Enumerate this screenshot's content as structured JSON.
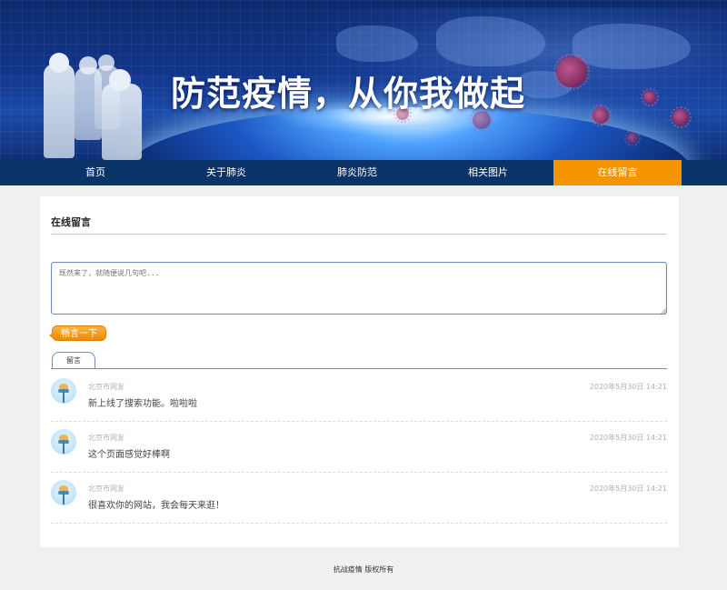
{
  "banner": {
    "title": "防范疫情，从你我做起"
  },
  "nav": {
    "items": [
      {
        "label": "首页"
      },
      {
        "label": "关于肺炎"
      },
      {
        "label": "肺炎防范"
      },
      {
        "label": "相关图片"
      },
      {
        "label": "在线留言",
        "active": true
      }
    ]
  },
  "panel": {
    "title": "在线留言",
    "input_placeholder": "既然来了，就随便说几句吧...",
    "submit_label": "畅言一下",
    "tab_label": "留言"
  },
  "comments": [
    {
      "author": "北京市网友",
      "time": "2020年5月30日 14:21",
      "text": "新上线了搜索功能。啦啦啦"
    },
    {
      "author": "北京市网友",
      "time": "2020年5月30日 14:21",
      "text": "这个页面感觉好棒啊"
    },
    {
      "author": "北京市网友",
      "time": "2020年5月30日 14:21",
      "text": "很喜欢你的网站，我会每天来逛！"
    }
  ],
  "footer": {
    "text": "抗战疫情 版权所有"
  },
  "colors": {
    "nav_bg": "#0a3468",
    "nav_active": "#f59400",
    "button": "#f08a00",
    "input_border": "#6a8fc0"
  },
  "icons": {
    "avatar": "user-avatar-icon"
  }
}
